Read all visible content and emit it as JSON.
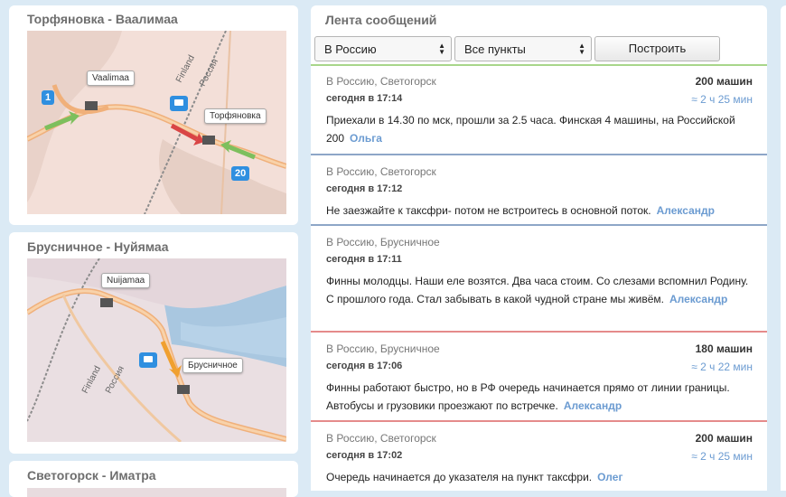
{
  "cards": [
    {
      "title": "Торфяновка - Ваалимаа",
      "labels": [
        "Vaalimaa",
        "Торфяновка"
      ],
      "badges": [
        "1",
        "20"
      ],
      "border_labels": [
        "Finland",
        "Россия"
      ]
    },
    {
      "title": "Брусничное - Нуйямаа",
      "labels": [
        "Nuijamaa",
        "Брусничное"
      ],
      "badges": [],
      "border_labels": [
        "Finland",
        "Россия"
      ]
    },
    {
      "title": "Светогорск - Иматра"
    }
  ],
  "feed": {
    "title": "Лента сообщений",
    "direction_select": "В Россию",
    "points_select": "Все пункты",
    "build_button": "Построить",
    "messages": [
      {
        "route": "В Россию, Светогорск",
        "cars": "200 машин",
        "time": "сегодня в 17:14",
        "eta": "≈ 2 ч 25 мин",
        "text": "Приехали в 14.30 по мск, прошли за 2.5 часа. Финская 4 машины, на Российской 200",
        "author": "Ольга",
        "color": "#8da6c7"
      },
      {
        "route": "В Россию, Светогорск",
        "cars": "",
        "time": "сегодня в 17:12",
        "eta": "",
        "text": "Не заезжайте к таксфри- потом не встроитесь в основной поток.",
        "author": "Александр",
        "color": "#8da6c7"
      },
      {
        "route": "В Россию, Брусничное",
        "cars": "",
        "time": "сегодня в 17:11",
        "eta": "",
        "text": "Финны молодцы. Наши еле возятся. Два часа стоим. Со слезами вспомнил Родину. С прошлого года. Стал забывать в какой чудной стране мы живём.",
        "author": "Александр",
        "color": "#e58b8b"
      },
      {
        "route": "В Россию, Брусничное",
        "cars": "180 машин",
        "time": "сегодня в 17:06",
        "eta": "≈ 2 ч 22 мин",
        "text": "Финны работают быстро, но в РФ очередь начинается прямо от линии границы. Автобусы и грузовики проезжают по встречке.",
        "author": "Александр",
        "color": "#e58b8b"
      },
      {
        "route": "В Россию, Светогорск",
        "cars": "200 машин",
        "time": "сегодня в 17:02",
        "eta": "≈ 2 ч 25 мин",
        "text": "Очередь начинается до указателя на пункт таксфри.",
        "author": "Олег",
        "color": "#8da6c7"
      }
    ]
  }
}
